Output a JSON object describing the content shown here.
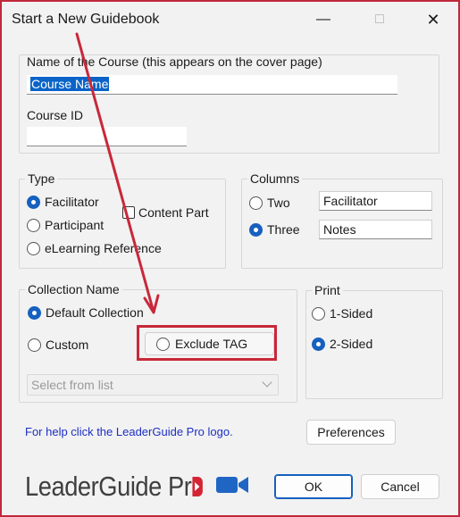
{
  "window": {
    "title": "Start a New Guidebook"
  },
  "course": {
    "name_label": "Name of the Course (this appears on the cover page)",
    "name_value": "Course Name",
    "id_label": "Course ID",
    "id_value": ""
  },
  "type": {
    "legend": "Type",
    "options": [
      {
        "label": "Facilitator",
        "checked": true
      },
      {
        "label": "Participant",
        "checked": false
      },
      {
        "label": "eLearning Reference",
        "checked": false
      }
    ],
    "content_part_label": "Content Part",
    "content_part_checked": false
  },
  "columns": {
    "legend": "Columns",
    "options": [
      {
        "label": "Two",
        "value": "Facilitator",
        "checked": false
      },
      {
        "label": "Three",
        "value": "Notes",
        "checked": true
      }
    ]
  },
  "collection": {
    "legend": "Collection Name",
    "default_label": "Default Collection",
    "custom_label": "Custom",
    "exclude_label": "Exclude TAG",
    "select_placeholder": "Select from list"
  },
  "print": {
    "legend": "Print",
    "one_sided_label": "1-Sided",
    "two_sided_label": "2-Sided",
    "selected": "2-Sided"
  },
  "help_text": "For help click the LeaderGuide Pro logo.",
  "buttons": {
    "preferences": "Preferences",
    "ok": "OK",
    "cancel": "Cancel"
  },
  "logo": {
    "text": "LeaderGuide Pr"
  },
  "icons": {
    "video": "video-camera-icon"
  },
  "colors": {
    "accent": "#1660bf",
    "annotation": "#c8283a",
    "link": "#1d2fc4"
  }
}
